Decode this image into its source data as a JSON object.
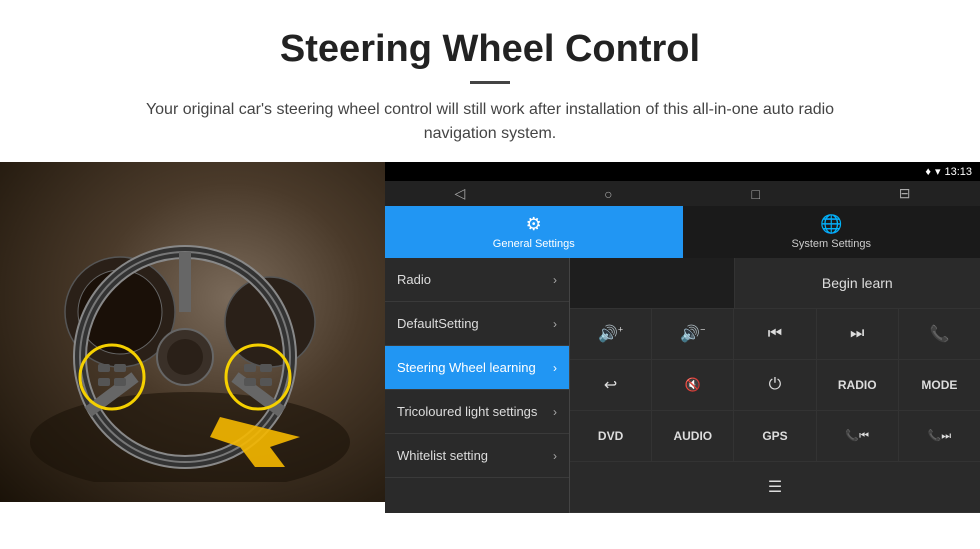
{
  "header": {
    "title": "Steering Wheel Control",
    "subtitle": "Your original car's steering wheel control will still work after installation of this all-in-one auto radio navigation system."
  },
  "status_bar": {
    "time": "13:13",
    "wifi_icon": "wifi",
    "signal_icon": "signal"
  },
  "nav_bar": {
    "back": "◁",
    "home": "○",
    "recent": "□",
    "menu": "⊟"
  },
  "tabs": [
    {
      "id": "general",
      "label": "General Settings",
      "active": true
    },
    {
      "id": "system",
      "label": "System Settings",
      "active": false
    }
  ],
  "menu_items": [
    {
      "label": "Radio",
      "active": false
    },
    {
      "label": "DefaultSetting",
      "active": false
    },
    {
      "label": "Steering Wheel learning",
      "active": true
    },
    {
      "label": "Tricoloured light settings",
      "active": false
    },
    {
      "label": "Whitelist setting",
      "active": false
    }
  ],
  "controls": {
    "begin_learn": "Begin learn",
    "buttons_row1": [
      "🔊+",
      "🔊−",
      "⏮",
      "⏭",
      "📞"
    ],
    "buttons_row2": [
      "↩",
      "🔊✕",
      "⏻",
      "RADIO",
      "MODE"
    ],
    "buttons_row3": [
      "DVD",
      "AUDIO",
      "GPS",
      "📞⏮",
      "📞⏭"
    ],
    "buttons_row4_icon": "≡"
  }
}
